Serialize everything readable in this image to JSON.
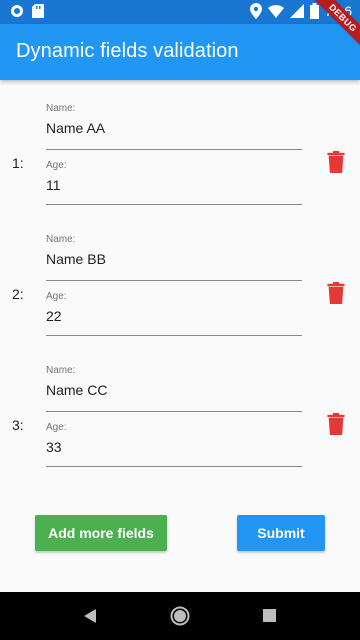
{
  "status": {
    "time": "7:06"
  },
  "appbar": {
    "title": "Dynamic fields validation"
  },
  "debug_banner": "DEBUG",
  "entries": [
    {
      "index": "1:",
      "name_label": "Name:",
      "name_value": "Name AA",
      "age_label": "Age:",
      "age_value": "11"
    },
    {
      "index": "2:",
      "name_label": "Name:",
      "name_value": "Name BB",
      "age_label": "Age:",
      "age_value": "22"
    },
    {
      "index": "3:",
      "name_label": "Name:",
      "name_value": "Name CC",
      "age_label": "Age:",
      "age_value": "33"
    }
  ],
  "buttons": {
    "add_label": "Add more fields",
    "submit_label": "Submit"
  },
  "colors": {
    "primary": "#2196f3",
    "status_bar": "#1976d2",
    "add_button": "#4caf50",
    "delete_icon": "#e53935"
  },
  "icons": [
    "circle-status-icon",
    "sd-card-icon",
    "location-pin-icon",
    "wifi-icon",
    "signal-icon",
    "battery-icon",
    "delete-icon",
    "back-icon",
    "home-icon",
    "recents-icon"
  ]
}
